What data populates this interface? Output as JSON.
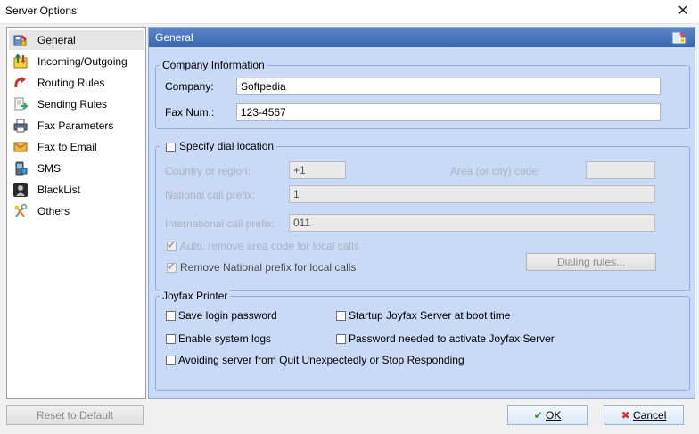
{
  "window": {
    "title": "Server Options",
    "close_glyph": "✕"
  },
  "sidebar": {
    "items": [
      {
        "label": "General",
        "icon": "general-icon",
        "selected": true
      },
      {
        "label": "Incoming/Outgoing",
        "icon": "incoming-outgoing-icon"
      },
      {
        "label": "Routing Rules",
        "icon": "routing-rules-icon"
      },
      {
        "label": "Sending Rules",
        "icon": "sending-rules-icon"
      },
      {
        "label": "Fax Parameters",
        "icon": "fax-parameters-icon"
      },
      {
        "label": "Fax to Email",
        "icon": "fax-to-email-icon"
      },
      {
        "label": "SMS",
        "icon": "sms-icon"
      },
      {
        "label": "BlackList",
        "icon": "blacklist-icon"
      },
      {
        "label": "Others",
        "icon": "others-icon"
      }
    ]
  },
  "panel": {
    "title": "General"
  },
  "company": {
    "legend": "Company Information",
    "company_label": "Company:",
    "company_value": "Softpedia",
    "fax_label": "Fax Num.:",
    "fax_value": "123-4567"
  },
  "dial": {
    "legend": "Specify dial location",
    "checked": false,
    "country_label": "Country or region:",
    "country_value": "+1",
    "area_label": "Area (or city) code:",
    "area_value": "",
    "national_label": "National call prefix:",
    "national_value": "1",
    "international_label": "International call prefix:",
    "international_value": "011",
    "auto_remove_label": "Auto. remove area code for local calls",
    "remove_national_label": "Remove National prefix for local calls",
    "dialing_rules_label": "Dialing rules..."
  },
  "printer": {
    "legend": "Joyfax Printer",
    "save_login_label": "Save login password",
    "startup_label": "Startup Joyfax Server at boot time",
    "enable_logs_label": "Enable system logs",
    "password_needed_label": "Password needed to activate Joyfax Server",
    "avoiding_label": "Avoiding server from Quit Unexpectedly or Stop Responding"
  },
  "footer": {
    "reset_label": "Reset to Default",
    "ok_label": "OK",
    "cancel_label": "Cancel"
  },
  "colors": {
    "panel_bg": "#c8daf6",
    "header_bg": "#3966b0",
    "ok_tick": "#2e9a2e",
    "cancel_x": "#d03030"
  }
}
